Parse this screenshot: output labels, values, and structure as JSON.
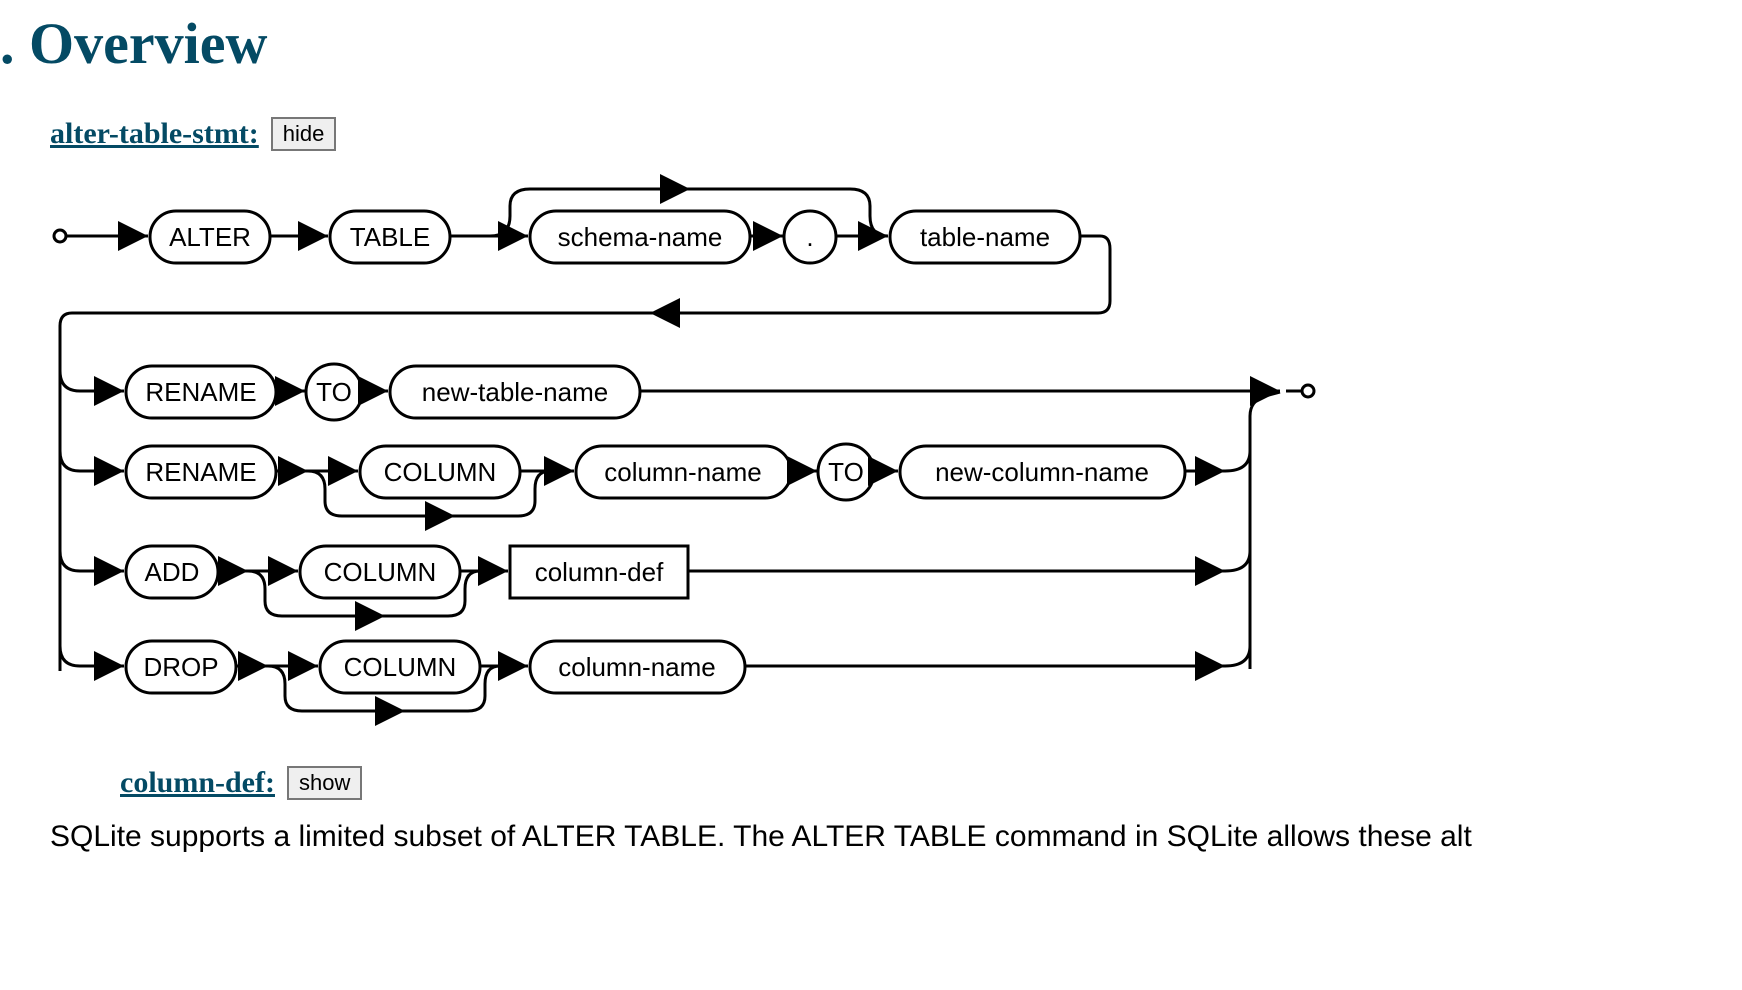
{
  "heading_prefix": ".",
  "heading": "Overview",
  "section1": {
    "label": "alter-table-stmt:",
    "toggle": "hide"
  },
  "section2": {
    "label": "column-def:",
    "toggle": "show"
  },
  "diagram": {
    "nodes": {
      "alter": "ALTER",
      "table": "TABLE",
      "schema_name": "schema-name",
      "dot": ".",
      "table_name": "table-name",
      "rename1": "RENAME",
      "to1": "TO",
      "new_table_name": "new-table-name",
      "rename2": "RENAME",
      "column2": "COLUMN",
      "column_name2": "column-name",
      "to2": "TO",
      "new_column_name": "new-column-name",
      "add": "ADD",
      "column3": "COLUMN",
      "column_def": "column-def",
      "drop": "DROP",
      "column4": "COLUMN",
      "column_name4": "column-name"
    }
  },
  "body_text": "SQLite supports a limited subset of ALTER TABLE. The ALTER TABLE command in SQLite allows these alt"
}
